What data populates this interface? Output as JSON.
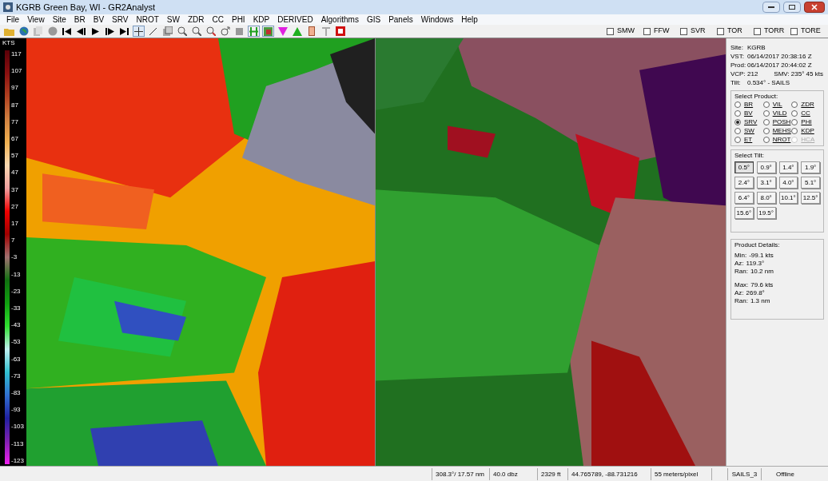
{
  "window": {
    "title": "KGRB Green Bay, WI - GR2Analyst"
  },
  "menu": [
    "File",
    "View",
    "Site",
    "BR",
    "BV",
    "SRV",
    "NROT",
    "SW",
    "ZDR",
    "CC",
    "PHI",
    "KDP",
    "DERIVED",
    "Algorithms",
    "GIS",
    "Panels",
    "Windows",
    "Help"
  ],
  "warnings": [
    {
      "label": "SMW",
      "checked": false
    },
    {
      "label": "FFW",
      "checked": false
    },
    {
      "label": "SVR",
      "checked": false
    },
    {
      "label": "TOR",
      "checked": false
    },
    {
      "label": "TORR",
      "checked": false
    },
    {
      "label": "TORE",
      "checked": false
    }
  ],
  "legend": {
    "unit": "KTS",
    "ticks": [
      "117",
      "107",
      "97",
      "87",
      "77",
      "67",
      "57",
      "47",
      "37",
      "27",
      "17",
      "7",
      "-3",
      "-13",
      "-23",
      "-33",
      "-43",
      "-53",
      "-63",
      "-73",
      "-83",
      "-93",
      "-103",
      "-113",
      "-123"
    ]
  },
  "site_info": [
    {
      "label": "Site:",
      "value": "KGRB"
    },
    {
      "label": "VST:",
      "value": "06/14/2017  20:38:16 Z"
    },
    {
      "label": "Prod:",
      "value": "06/14/2017  20:44:02 Z"
    },
    {
      "label": "VCP:",
      "value": "212",
      "extra": "SMV: 235° 45 kts"
    },
    {
      "label": "Tilt:",
      "value": "0.534° - SAILS"
    }
  ],
  "products": {
    "title": "Select Product:",
    "items": [
      {
        "label": "BR",
        "selected": false,
        "disabled": false
      },
      {
        "label": "VIL",
        "selected": false,
        "disabled": false
      },
      {
        "label": "ZDR",
        "selected": false,
        "disabled": false
      },
      {
        "label": "BV",
        "selected": false,
        "disabled": false
      },
      {
        "label": "VILD",
        "selected": false,
        "disabled": false
      },
      {
        "label": "CC",
        "selected": false,
        "disabled": false
      },
      {
        "label": "SRV",
        "selected": true,
        "disabled": false
      },
      {
        "label": "POSH",
        "selected": false,
        "disabled": false
      },
      {
        "label": "PHI",
        "selected": false,
        "disabled": false
      },
      {
        "label": "SW",
        "selected": false,
        "disabled": false
      },
      {
        "label": "MEHS",
        "selected": false,
        "disabled": false
      },
      {
        "label": "KDP",
        "selected": false,
        "disabled": false
      },
      {
        "label": "ET",
        "selected": false,
        "disabled": false
      },
      {
        "label": "NROT",
        "selected": false,
        "disabled": false
      },
      {
        "label": "HCA",
        "selected": false,
        "disabled": true
      }
    ]
  },
  "tilts": {
    "title": "Select Tilt:",
    "items": [
      {
        "label": "0.5°",
        "selected": true
      },
      {
        "label": "0.9°",
        "selected": false
      },
      {
        "label": "1.4°",
        "selected": false
      },
      {
        "label": "1.9°",
        "selected": false
      },
      {
        "label": "2.4°",
        "selected": false
      },
      {
        "label": "3.1°",
        "selected": false
      },
      {
        "label": "4.0°",
        "selected": false
      },
      {
        "label": "5.1°",
        "selected": false
      },
      {
        "label": "6.4°",
        "selected": false
      },
      {
        "label": "8.0°",
        "selected": false
      },
      {
        "label": "10.1°",
        "selected": false
      },
      {
        "label": "12.5°",
        "selected": false
      },
      {
        "label": "15.6°",
        "selected": false
      },
      {
        "label": "19.5°",
        "selected": false
      }
    ]
  },
  "details": {
    "title": "Product Details:",
    "groups": [
      [
        {
          "label": "Min:",
          "value": "-99.1 kts"
        },
        {
          "label": "Az:",
          "value": "119.3°"
        },
        {
          "label": "Ran:",
          "value": "10.2 nm"
        }
      ],
      [
        {
          "label": "Max:",
          "value": "79.6 kts"
        },
        {
          "label": "Az:",
          "value": "269.8°"
        },
        {
          "label": "Ran:",
          "value": "1.3 nm"
        }
      ]
    ]
  },
  "status_bar": [
    "308.3°/ 17.57 nm",
    "40.0 dbz",
    "2329 ft",
    "44.765789, -88.731216",
    "55 meters/pixel",
    "SAILS_3",
    "Offline"
  ]
}
